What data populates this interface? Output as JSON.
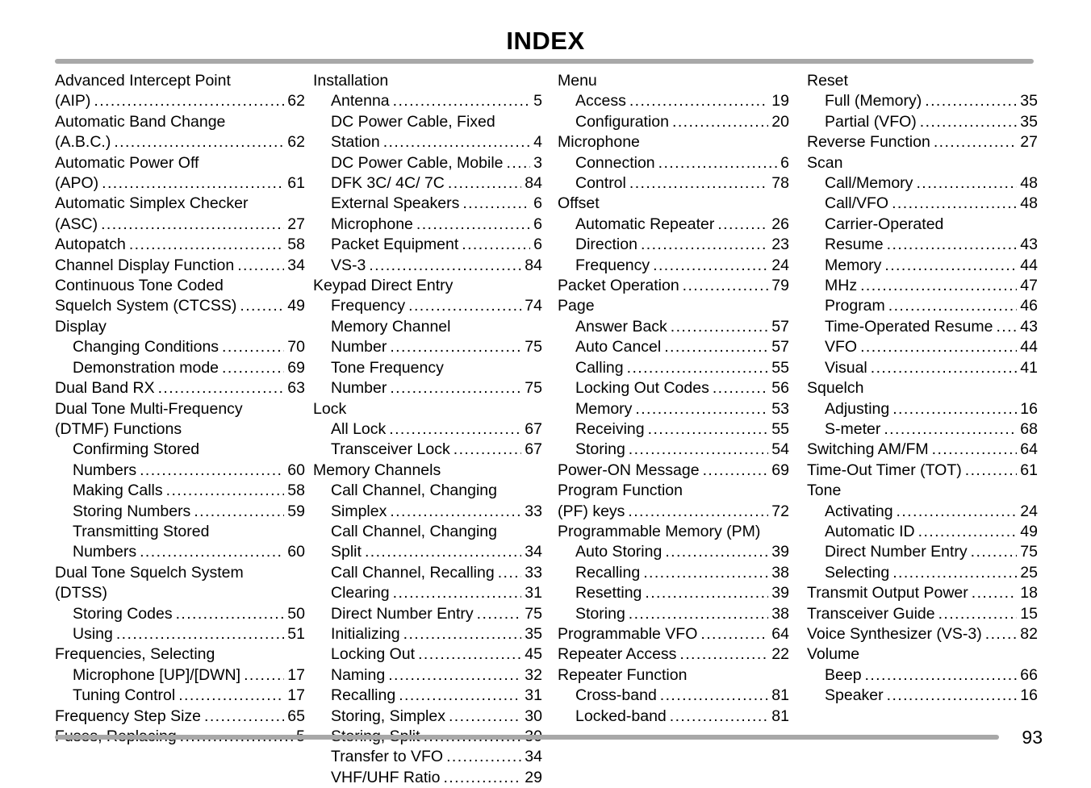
{
  "document": {
    "title": "INDEX",
    "page_number": "93",
    "rule_color": "#a8a8a8"
  },
  "columns": [
    {
      "id": "column-1",
      "entries": [
        {
          "type": "cont",
          "label": "Advanced Intercept Point"
        },
        {
          "type": "main",
          "label": "(AIP)",
          "page": "62"
        },
        {
          "type": "cont",
          "label": "Automatic Band Change"
        },
        {
          "type": "main",
          "label": "(A.B.C.)",
          "page": "62"
        },
        {
          "type": "cont",
          "label": "Automatic Power Off"
        },
        {
          "type": "main",
          "label": "(APO)",
          "page": "61"
        },
        {
          "type": "cont",
          "label": "Automatic Simplex Checker"
        },
        {
          "type": "main",
          "label": "(ASC)",
          "page": "27"
        },
        {
          "type": "main",
          "label": "Autopatch",
          "page": "58"
        },
        {
          "type": "main",
          "label": "Channel Display Function",
          "page": "34"
        },
        {
          "type": "cont",
          "label": "Continuous Tone Coded"
        },
        {
          "type": "main",
          "label": "Squelch System (CTCSS)",
          "page": "49"
        },
        {
          "type": "heading",
          "label": "Display"
        },
        {
          "type": "sub",
          "label": "Changing Conditions",
          "page": "70"
        },
        {
          "type": "sub",
          "label": "Demonstration mode",
          "page": "69"
        },
        {
          "type": "main",
          "label": "Dual Band RX",
          "page": "63"
        },
        {
          "type": "cont",
          "label": "Dual Tone Multi-Frequency"
        },
        {
          "type": "heading",
          "label": "(DTMF) Functions"
        },
        {
          "type": "sub cont",
          "label": "Confirming Stored"
        },
        {
          "type": "sub",
          "label": "Numbers",
          "page": "60"
        },
        {
          "type": "sub",
          "label": "Making Calls",
          "page": "58"
        },
        {
          "type": "sub",
          "label": "Storing Numbers",
          "page": "59"
        },
        {
          "type": "sub cont",
          "label": "Transmitting Stored"
        },
        {
          "type": "sub",
          "label": "Numbers",
          "page": "60"
        },
        {
          "type": "cont",
          "label": "Dual Tone Squelch System"
        },
        {
          "type": "heading",
          "label": "(DTSS)"
        },
        {
          "type": "sub",
          "label": "Storing Codes",
          "page": "50"
        },
        {
          "type": "sub",
          "label": "Using",
          "page": "51"
        },
        {
          "type": "heading",
          "label": "Frequencies, Selecting"
        },
        {
          "type": "sub",
          "label": "Microphone [UP]/[DWN]",
          "page": "17"
        },
        {
          "type": "sub",
          "label": "Tuning Control",
          "page": "17"
        },
        {
          "type": "main",
          "label": "Frequency Step Size",
          "page": "65"
        },
        {
          "type": "main",
          "label": "Fuses, Replacing",
          "page": "5"
        }
      ]
    },
    {
      "id": "column-2",
      "entries": [
        {
          "type": "heading",
          "label": "Installation"
        },
        {
          "type": "sub",
          "label": "Antenna",
          "page": "5"
        },
        {
          "type": "sub cont",
          "label": "DC Power Cable, Fixed"
        },
        {
          "type": "sub",
          "label": "Station",
          "page": "4"
        },
        {
          "type": "sub",
          "label": "DC Power Cable, Mobile",
          "page": "3"
        },
        {
          "type": "sub",
          "label": "DFK 3C/ 4C/ 7C",
          "page": "84"
        },
        {
          "type": "sub",
          "label": "External Speakers",
          "page": "6"
        },
        {
          "type": "sub",
          "label": "Microphone",
          "page": "6"
        },
        {
          "type": "sub",
          "label": "Packet Equipment",
          "page": "6"
        },
        {
          "type": "sub",
          "label": "VS-3",
          "page": "84"
        },
        {
          "type": "heading",
          "label": "Keypad Direct Entry"
        },
        {
          "type": "sub",
          "label": "Frequency",
          "page": "74"
        },
        {
          "type": "sub cont",
          "label": "Memory Channel"
        },
        {
          "type": "sub",
          "label": "Number",
          "page": "75"
        },
        {
          "type": "sub cont",
          "label": "Tone Frequency"
        },
        {
          "type": "sub",
          "label": "Number",
          "page": "75"
        },
        {
          "type": "heading",
          "label": "Lock"
        },
        {
          "type": "sub",
          "label": "All Lock",
          "page": "67"
        },
        {
          "type": "sub",
          "label": "Transceiver Lock",
          "page": "67"
        },
        {
          "type": "heading",
          "label": "Memory Channels"
        },
        {
          "type": "sub cont",
          "label": "Call Channel, Changing"
        },
        {
          "type": "sub",
          "label": "Simplex",
          "page": "33"
        },
        {
          "type": "sub cont",
          "label": "Call Channel, Changing"
        },
        {
          "type": "sub",
          "label": "Split",
          "page": "34"
        },
        {
          "type": "sub",
          "label": "Call Channel, Recalling",
          "page": "33"
        },
        {
          "type": "sub",
          "label": "Clearing",
          "page": "31"
        },
        {
          "type": "sub",
          "label": "Direct Number Entry",
          "page": "75"
        },
        {
          "type": "sub",
          "label": "Initializing",
          "page": "35"
        },
        {
          "type": "sub",
          "label": "Locking Out",
          "page": "45"
        },
        {
          "type": "sub",
          "label": "Naming",
          "page": "32"
        },
        {
          "type": "sub",
          "label": "Recalling",
          "page": "31"
        },
        {
          "type": "sub",
          "label": "Storing, Simplex",
          "page": "30"
        },
        {
          "type": "sub",
          "label": "Storing, Split",
          "page": "30"
        },
        {
          "type": "sub",
          "label": "Transfer to VFO",
          "page": "34"
        },
        {
          "type": "sub",
          "label": "VHF/UHF Ratio",
          "page": "29"
        }
      ]
    },
    {
      "id": "column-3",
      "entries": [
        {
          "type": "heading",
          "label": "Menu"
        },
        {
          "type": "sub",
          "label": "Access",
          "page": "19"
        },
        {
          "type": "sub",
          "label": "Configuration",
          "page": "20"
        },
        {
          "type": "heading",
          "label": "Microphone"
        },
        {
          "type": "sub",
          "label": "Connection",
          "page": "6"
        },
        {
          "type": "sub",
          "label": "Control",
          "page": "78"
        },
        {
          "type": "heading",
          "label": "Offset"
        },
        {
          "type": "sub",
          "label": "Automatic Repeater",
          "page": "26"
        },
        {
          "type": "sub",
          "label": "Direction",
          "page": "23"
        },
        {
          "type": "sub",
          "label": "Frequency",
          "page": "24"
        },
        {
          "type": "main",
          "label": "Packet Operation",
          "page": "79"
        },
        {
          "type": "heading",
          "label": "Page"
        },
        {
          "type": "sub",
          "label": "Answer Back",
          "page": "57"
        },
        {
          "type": "sub",
          "label": "Auto Cancel",
          "page": "57"
        },
        {
          "type": "sub",
          "label": "Calling",
          "page": "55"
        },
        {
          "type": "sub",
          "label": "Locking Out Codes",
          "page": "56"
        },
        {
          "type": "sub",
          "label": "Memory",
          "page": "53"
        },
        {
          "type": "sub",
          "label": "Receiving",
          "page": "55"
        },
        {
          "type": "sub",
          "label": "Storing",
          "page": "54"
        },
        {
          "type": "main",
          "label": "Power-ON Message",
          "page": "69"
        },
        {
          "type": "cont",
          "label": "Program Function"
        },
        {
          "type": "main",
          "label": "(PF) keys",
          "page": "72"
        },
        {
          "type": "heading",
          "label": "Programmable Memory (PM)"
        },
        {
          "type": "sub",
          "label": "Auto Storing",
          "page": "39"
        },
        {
          "type": "sub",
          "label": "Recalling",
          "page": "38"
        },
        {
          "type": "sub",
          "label": "Resetting",
          "page": "39"
        },
        {
          "type": "sub",
          "label": "Storing",
          "page": "38"
        },
        {
          "type": "main",
          "label": "Programmable VFO",
          "page": "64"
        },
        {
          "type": "main",
          "label": "Repeater Access",
          "page": "22"
        },
        {
          "type": "heading",
          "label": "Repeater Function"
        },
        {
          "type": "sub",
          "label": "Cross-band",
          "page": "81"
        },
        {
          "type": "sub",
          "label": "Locked-band",
          "page": "81"
        }
      ]
    },
    {
      "id": "column-4",
      "entries": [
        {
          "type": "heading",
          "label": "Reset"
        },
        {
          "type": "sub",
          "label": "Full (Memory)",
          "page": "35"
        },
        {
          "type": "sub",
          "label": "Partial (VFO)",
          "page": "35"
        },
        {
          "type": "main",
          "label": "Reverse Function",
          "page": "27"
        },
        {
          "type": "heading",
          "label": "Scan"
        },
        {
          "type": "sub",
          "label": "Call/Memory",
          "page": "48"
        },
        {
          "type": "sub",
          "label": "Call/VFO",
          "page": "48"
        },
        {
          "type": "sub cont",
          "label": "Carrier-Operated"
        },
        {
          "type": "sub",
          "label": "Resume",
          "page": "43"
        },
        {
          "type": "sub",
          "label": "Memory",
          "page": "44"
        },
        {
          "type": "sub",
          "label": "MHz",
          "page": "47"
        },
        {
          "type": "sub",
          "label": "Program",
          "page": "46"
        },
        {
          "type": "sub",
          "label": "Time-Operated Resume",
          "page": "43"
        },
        {
          "type": "sub",
          "label": "VFO",
          "page": "44"
        },
        {
          "type": "sub",
          "label": "Visual",
          "page": "41"
        },
        {
          "type": "heading",
          "label": "Squelch"
        },
        {
          "type": "sub",
          "label": "Adjusting",
          "page": "16"
        },
        {
          "type": "sub",
          "label": "S-meter",
          "page": "68"
        },
        {
          "type": "main",
          "label": "Switching AM/FM",
          "page": "64"
        },
        {
          "type": "main",
          "label": "Time-Out Timer (TOT)",
          "page": "61"
        },
        {
          "type": "heading",
          "label": "Tone"
        },
        {
          "type": "sub",
          "label": "Activating",
          "page": "24"
        },
        {
          "type": "sub",
          "label": "Automatic ID",
          "page": "49"
        },
        {
          "type": "sub",
          "label": "Direct Number Entry",
          "page": "75"
        },
        {
          "type": "sub",
          "label": "Selecting",
          "page": "25"
        },
        {
          "type": "main",
          "label": "Transmit Output Power",
          "page": "18"
        },
        {
          "type": "main",
          "label": "Transceiver Guide",
          "page": "15"
        },
        {
          "type": "main",
          "label": "Voice Synthesizer (VS-3)",
          "page": "82"
        },
        {
          "type": "heading",
          "label": "Volume"
        },
        {
          "type": "sub",
          "label": "Beep",
          "page": "66"
        },
        {
          "type": "sub",
          "label": "Speaker",
          "page": "16"
        }
      ]
    }
  ]
}
